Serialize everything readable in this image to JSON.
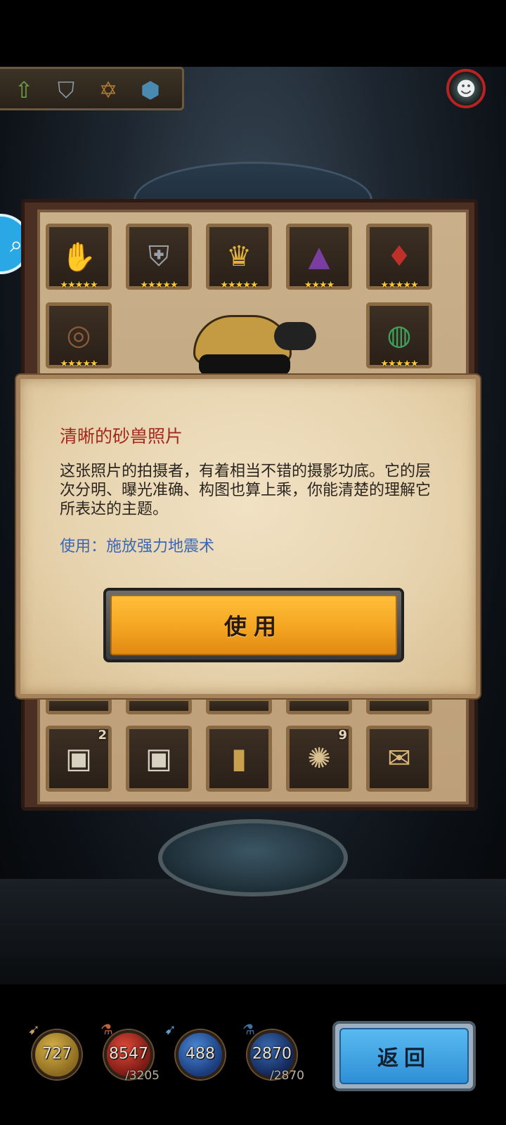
{
  "top_bar": {
    "icons": [
      "arrow-up-icon",
      "shield-icon",
      "hexagram-icon",
      "turtle-shell-icon"
    ]
  },
  "profile": {
    "icon": "monster-avatar-icon"
  },
  "search": {
    "icon": "search-icon"
  },
  "inventory": {
    "rows": [
      [
        {
          "icon": "gauntlet-icon",
          "stars": "★★★★★"
        },
        {
          "icon": "chainmail-icon",
          "stars": "★★★★★"
        },
        {
          "icon": "crown-icon",
          "stars": "★★★★★"
        },
        {
          "icon": "wizard-hat-icon",
          "stars": "★★★★"
        },
        {
          "icon": "amulet-icon",
          "stars": "★★★★★"
        }
      ],
      [
        {
          "icon": "belt-icon",
          "stars": "★★★★★"
        },
        {
          "icon": "emerald-ring-icon",
          "stars": "★★★★★"
        }
      ],
      [
        {
          "icon": "photo-rose-icon",
          "count": "2"
        },
        {
          "icon": "photo-rose-icon",
          "count": ""
        },
        {
          "icon": "gold-card-icon",
          "count": ""
        },
        {
          "icon": "scroll-book-icon",
          "count": "9"
        },
        {
          "icon": "map-scroll-icon",
          "count": ""
        }
      ]
    ]
  },
  "dialog": {
    "title": "清晰的砂兽照片",
    "description": "这张照片的拍摄者，有着相当不错的摄影功底。它的层次分明、曝光准确、构图也算上乘，你能清楚的理解它所表达的主题。",
    "usage": "使用：施放强力地震术",
    "use_button": "使用"
  },
  "resources": [
    {
      "icon": "gold-coin-icon",
      "value": "727",
      "max": ""
    },
    {
      "icon": "health-orb-icon",
      "value": "8547",
      "max": "/3205"
    },
    {
      "icon": "mana-orb-icon",
      "value": "488",
      "max": ""
    },
    {
      "icon": "blue-orb-icon",
      "value": "2870",
      "max": "/2870"
    }
  ],
  "back_button": "返回",
  "colors": {
    "title_red": "#a1291f",
    "usage_blue": "#3b67b5",
    "use_button_gold": "#f4a521",
    "back_button_blue": "#2f8fd6"
  }
}
